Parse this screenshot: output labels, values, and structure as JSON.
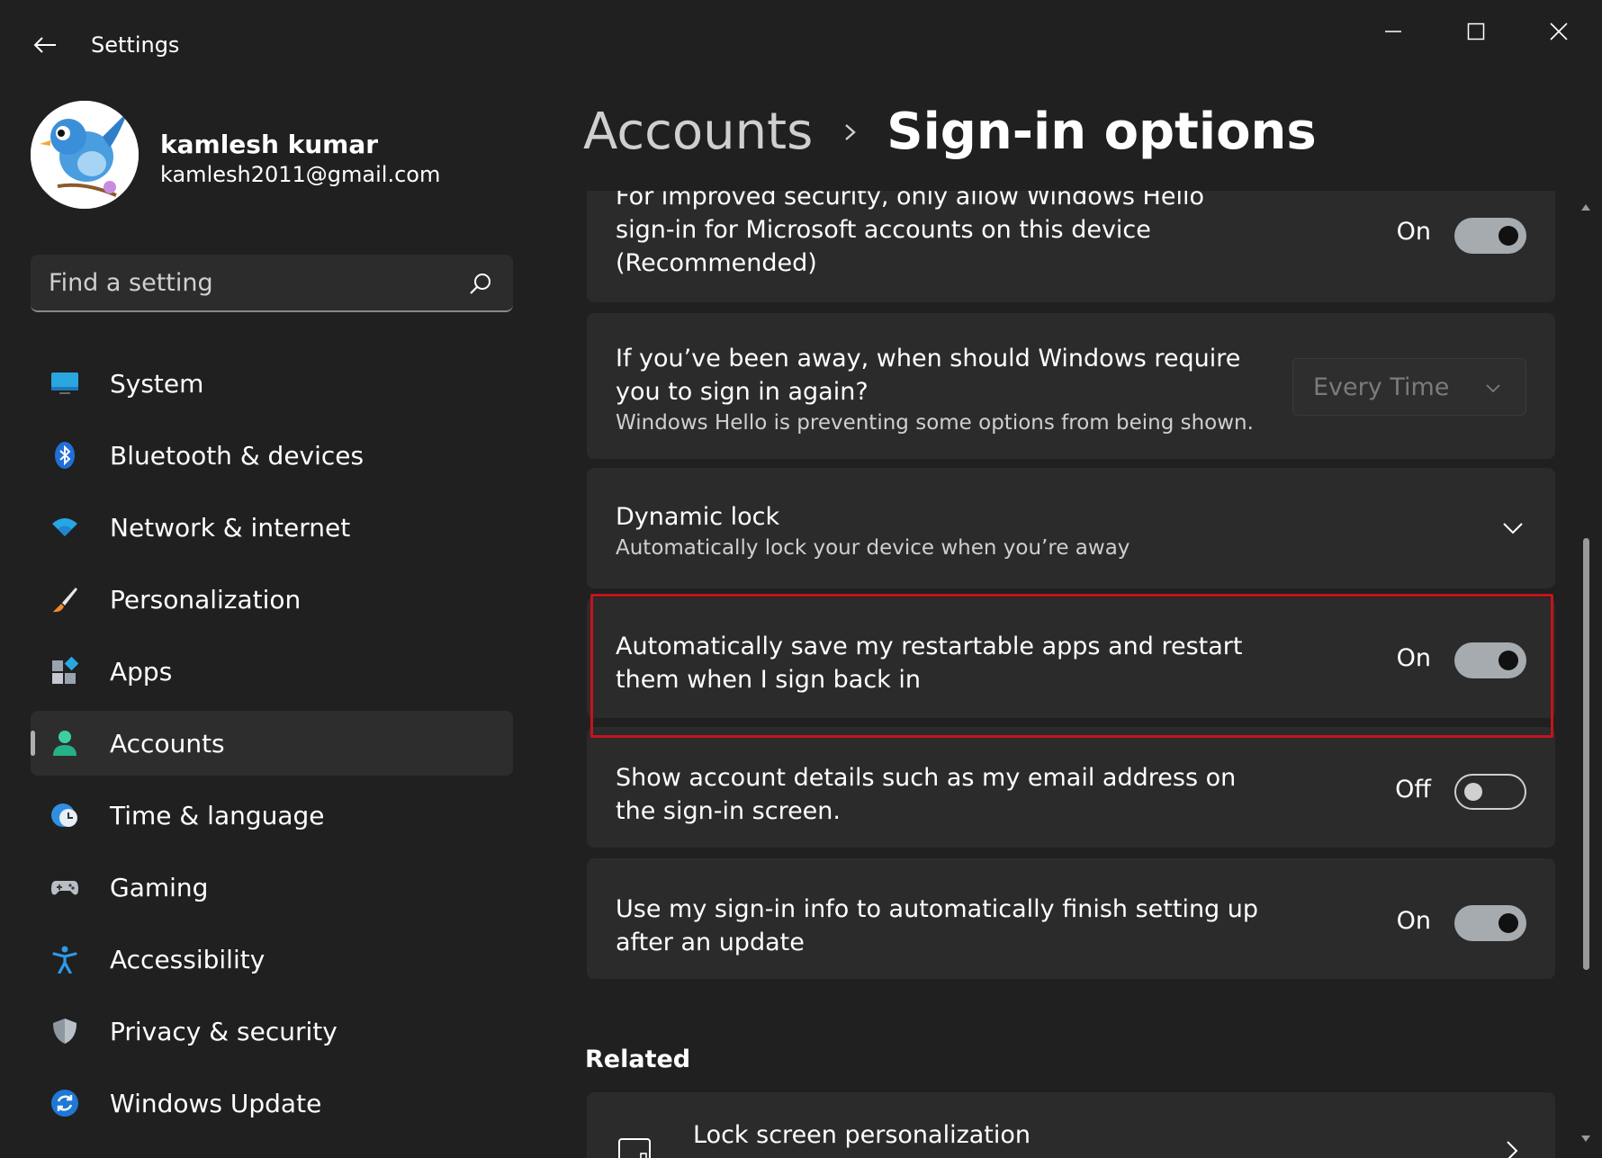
{
  "window": {
    "title": "Settings"
  },
  "profile": {
    "name": "kamlesh kumar",
    "email": "kamlesh2011@gmail.com"
  },
  "search": {
    "placeholder": "Find a setting"
  },
  "nav": {
    "items": [
      {
        "label": "System",
        "icon": "system-icon"
      },
      {
        "label": "Bluetooth & devices",
        "icon": "bluetooth-icon"
      },
      {
        "label": "Network & internet",
        "icon": "wifi-icon"
      },
      {
        "label": "Personalization",
        "icon": "brush-icon"
      },
      {
        "label": "Apps",
        "icon": "apps-icon"
      },
      {
        "label": "Accounts",
        "icon": "accounts-icon",
        "active": true
      },
      {
        "label": "Time & language",
        "icon": "globe-clock-icon"
      },
      {
        "label": "Gaming",
        "icon": "gamepad-icon"
      },
      {
        "label": "Accessibility",
        "icon": "accessibility-icon"
      },
      {
        "label": "Privacy & security",
        "icon": "shield-icon"
      },
      {
        "label": "Windows Update",
        "icon": "update-icon"
      }
    ]
  },
  "breadcrumb": {
    "parent": "Accounts",
    "current": "Sign-in options"
  },
  "settings": {
    "hello_only": {
      "text": "For improved security, only allow Windows Hello sign-in for Microsoft accounts on this device (Recommended)",
      "state": "On"
    },
    "require_signin": {
      "text": "If you’ve been away, when should Windows require you to sign in again?",
      "subtext": "Windows Hello is preventing some options from being shown.",
      "value": "Every Time"
    },
    "dynamic_lock": {
      "title": "Dynamic lock",
      "subtext": "Automatically lock your device when you’re away"
    },
    "restart_apps": {
      "text": "Automatically save my restartable apps and restart them when I sign back in",
      "state": "On"
    },
    "account_details": {
      "text": "Show account details such as my email address on the sign-in screen.",
      "state": "Off"
    },
    "finish_setup": {
      "text": "Use my sign-in info to automatically finish setting up after an update",
      "state": "On"
    }
  },
  "related": {
    "heading": "Related",
    "items": [
      {
        "label": "Lock screen personalization"
      }
    ]
  },
  "colors": {
    "background": "#202020",
    "card": "#2b2b2b",
    "highlight": "#c4141c",
    "toggle_on": "#a6abb0"
  }
}
